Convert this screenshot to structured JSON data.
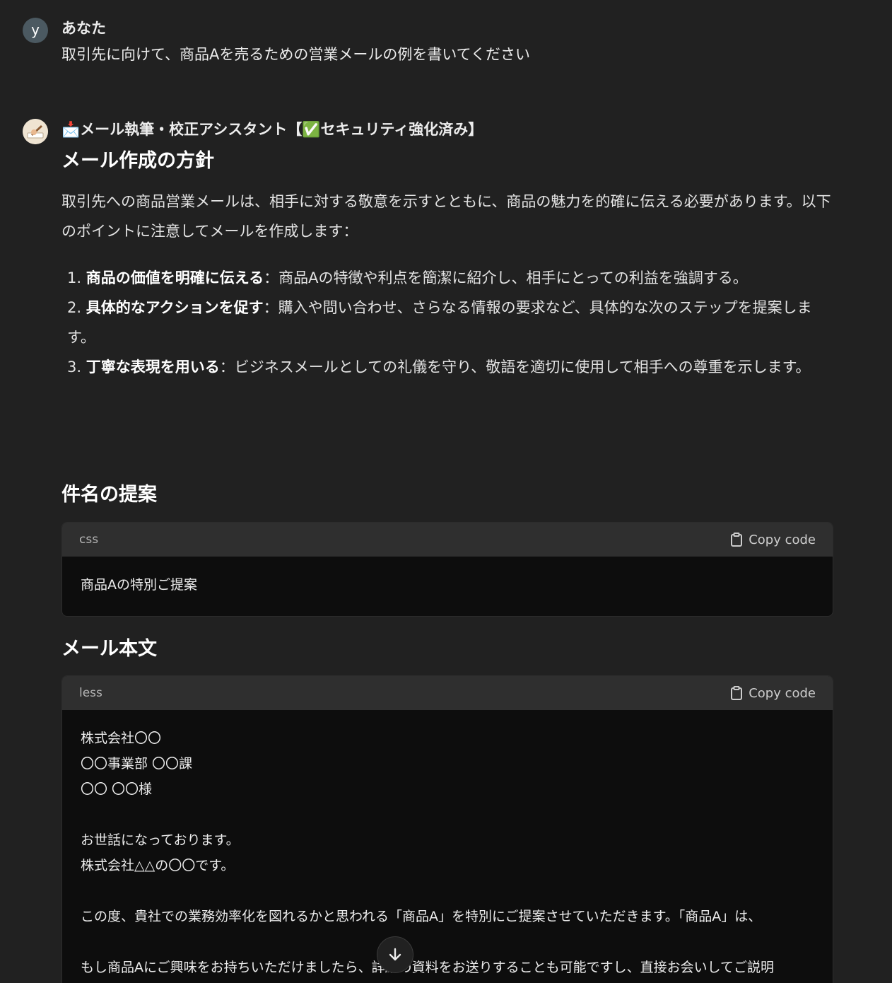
{
  "user_message": {
    "avatar_letter": "y",
    "author": "あなた",
    "text": "取引先に向けて、商品Aを売るための営業メールの例を書いてください"
  },
  "assistant_message": {
    "author_icon": "📩",
    "author_prefix": "メール執筆・校正アシスタント【",
    "author_check": "✅",
    "author_suffix": "セキュリティ強化済み】",
    "heading": "メール作成の方針",
    "intro": "取引先への商品営業メールは、相手に対する敬意を示すとともに、商品の魅力を的確に伝える必要があります。以下のポイントに注意してメールを作成します：",
    "points": [
      {
        "num": "1. ",
        "title": "商品の価値を明確に伝える",
        "text": "：商品Aの特徴や利点を簡潔に紹介し、相手にとっての利益を強調する。"
      },
      {
        "num": "2. ",
        "title": "具体的なアクションを促す",
        "text": "：購入や問い合わせ、さらなる情報の要求など、具体的な次のステップを提案します。"
      },
      {
        "num": "3. ",
        "title": "丁寧な表現を用いる",
        "text": "：ビジネスメールとしての礼儀を守り、敬語を適切に使用して相手への尊重を示します。"
      }
    ],
    "subject_heading": "件名の提案",
    "subject_code": {
      "lang": "css",
      "copy_label": "Copy code",
      "content": "商品Aの特別ご提案"
    },
    "body_heading": "メール本文",
    "body_code": {
      "lang": "less",
      "copy_label": "Copy code",
      "content": "株式会社〇〇\n〇〇事業部 〇〇課\n〇〇 〇〇様\n\nお世話になっております。\n株式会社△△の〇〇です。\n\nこの度、貴社での業務効率化を図れるかと思われる「商品A」を特別にご提案させていただきます。「商品A」は、\n\nもし商品Aにご興味をお持ちいただけましたら、詳細の資料をお送りすることも可能ですし、直接お会いしてご説明"
    }
  },
  "colors": {
    "background": "#212121",
    "code_header": "#2f2f2f",
    "code_body": "#0d0d0d",
    "check_green": "#2fb34a"
  }
}
